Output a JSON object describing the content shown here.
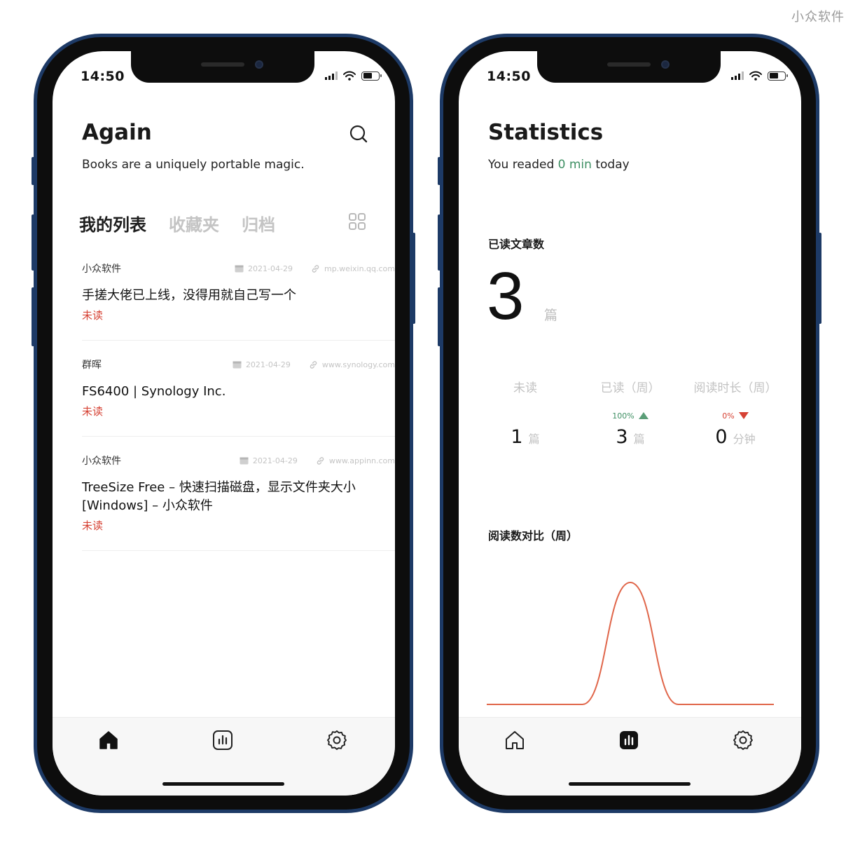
{
  "watermark": "小众软件",
  "status": {
    "time": "14:50"
  },
  "home": {
    "title": "Again",
    "subtitle": "Books are a uniquely portable magic.",
    "tabs": [
      {
        "label": "我的列表",
        "active": true
      },
      {
        "label": "收藏夹",
        "active": false
      },
      {
        "label": "归档",
        "active": false
      }
    ],
    "articles": [
      {
        "source": "小众软件",
        "date": "2021-04-29",
        "domain": "mp.weixin.qq.com",
        "title": "手搓大佬已上线，没得用就自己写一个",
        "status": "未读"
      },
      {
        "source": "群晖",
        "date": "2021-04-29",
        "domain": "www.synology.com",
        "title": "FS6400 | Synology Inc.",
        "status": "未读"
      },
      {
        "source": "小众软件",
        "date": "2021-04-29",
        "domain": "www.appinn.com",
        "title": "TreeSize Free – 快速扫描磁盘，显示文件夹大小[Windows] – 小众软件",
        "status": "未读"
      }
    ]
  },
  "stats": {
    "title": "Statistics",
    "subtitle_prefix": "You readed",
    "subtitle_value": "0 min",
    "subtitle_suffix": "today",
    "read_count_label": "已读文章数",
    "read_count": "3",
    "read_count_unit": "篇",
    "columns": [
      {
        "label": "未读",
        "change": "",
        "direction": "",
        "value": "1",
        "unit": "篇"
      },
      {
        "label": "已读（周）",
        "change": "100%",
        "direction": "up",
        "value": "3",
        "unit": "篇"
      },
      {
        "label": "阅读时长（周）",
        "change": "0%",
        "direction": "down",
        "value": "0",
        "unit": "分钟"
      }
    ],
    "chart_label": "阅读数对比（周）"
  },
  "chart_data": {
    "type": "line",
    "title": "阅读数对比（周）",
    "x": [
      0,
      1,
      2,
      3,
      4,
      5,
      6
    ],
    "series": [
      {
        "values": [
          0,
          0,
          0,
          3,
          0,
          0,
          0
        ],
        "color": "#e0664a"
      }
    ],
    "ylim": [
      0,
      3
    ],
    "grid": false,
    "legend": "none"
  },
  "colors": {
    "accent_green": "#3e8f63",
    "unread_red": "#d64234",
    "frame_blue": "#1d3a66",
    "chart_line": "#e0664a"
  },
  "icons": [
    "search-icon",
    "grid-icon",
    "calendar-icon",
    "link-icon",
    "home-icon",
    "chart-icon",
    "gear-icon",
    "wifi-icon",
    "signal-icon",
    "battery-icon"
  ]
}
